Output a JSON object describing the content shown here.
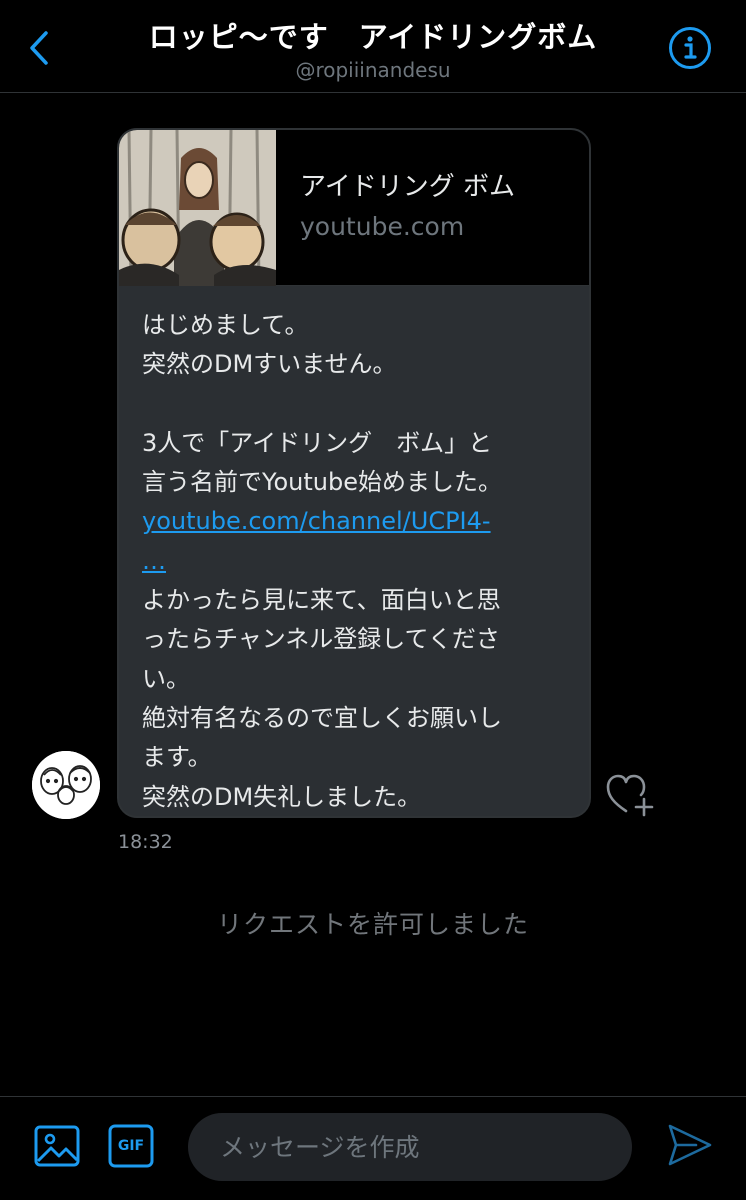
{
  "header": {
    "back_icon": "chevron-left-icon",
    "title": "ロッピ〜です　アイドリングボム",
    "handle": "@ropiiinandesu",
    "info_icon": "info-circle-icon"
  },
  "message": {
    "preview": {
      "title": "アイドリング ボム",
      "domain": "youtube.com"
    },
    "lines": [
      "はじめまして。",
      "突然のDMすいません。",
      "",
      "3人で「アイドリング　ボム」と",
      "言う名前でYoutube始めました。"
    ],
    "link_line1": "youtube.com/channel/UCPI4-",
    "link_line2": "…",
    "lines_after": [
      "よかったら見に来て、面白いと思",
      "ったらチャンネル登録してくださ",
      "い。",
      "絶対有名なるので宜しくお願いし",
      "ます。",
      "突然のDM失礼しました。"
    ],
    "timestamp": "18:32",
    "like_icon": "heart-plus-icon"
  },
  "system_note": "リクエストを許可しました",
  "composer": {
    "media_icon": "image-icon",
    "gif_icon": "gif-icon",
    "gif_label": "GIF",
    "placeholder": "メッセージを作成",
    "send_icon": "send-icon"
  },
  "colors": {
    "accent": "#1d9bf0",
    "background": "#000000",
    "bubble": "#2b2f33",
    "muted_text": "#6e767d"
  }
}
